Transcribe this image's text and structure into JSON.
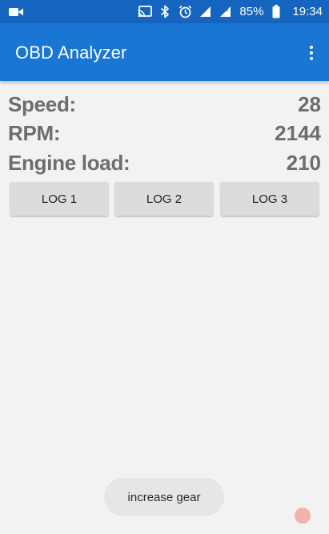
{
  "status_bar": {
    "left_icon": "video-camera-icon",
    "icons": [
      "cast-icon",
      "bluetooth-icon",
      "alarm-clock-icon",
      "signal-icon",
      "signal-roaming-icon",
      "battery-icon"
    ],
    "battery_percent": "85%",
    "time": "19:34"
  },
  "app_bar": {
    "title": "OBD Analyzer",
    "menu_icon": "overflow-menu-icon"
  },
  "metrics": [
    {
      "label": "Speed:",
      "value": "28"
    },
    {
      "label": "RPM:",
      "value": "2144"
    },
    {
      "label": "Engine load:",
      "value": "210"
    }
  ],
  "buttons": [
    {
      "label": "LOG 1"
    },
    {
      "label": "LOG 2"
    },
    {
      "label": "LOG 3"
    }
  ],
  "toast": {
    "message": "increase gear"
  },
  "colors": {
    "status_bar": "#1565c0",
    "app_bar": "#1976d2",
    "background": "#f2f2f2",
    "metric_text": "#6d6d6d",
    "button_bg": "#dcdcdc",
    "toast_bg": "#e6e6e6",
    "touch_indicator": "#f3a7a0"
  }
}
